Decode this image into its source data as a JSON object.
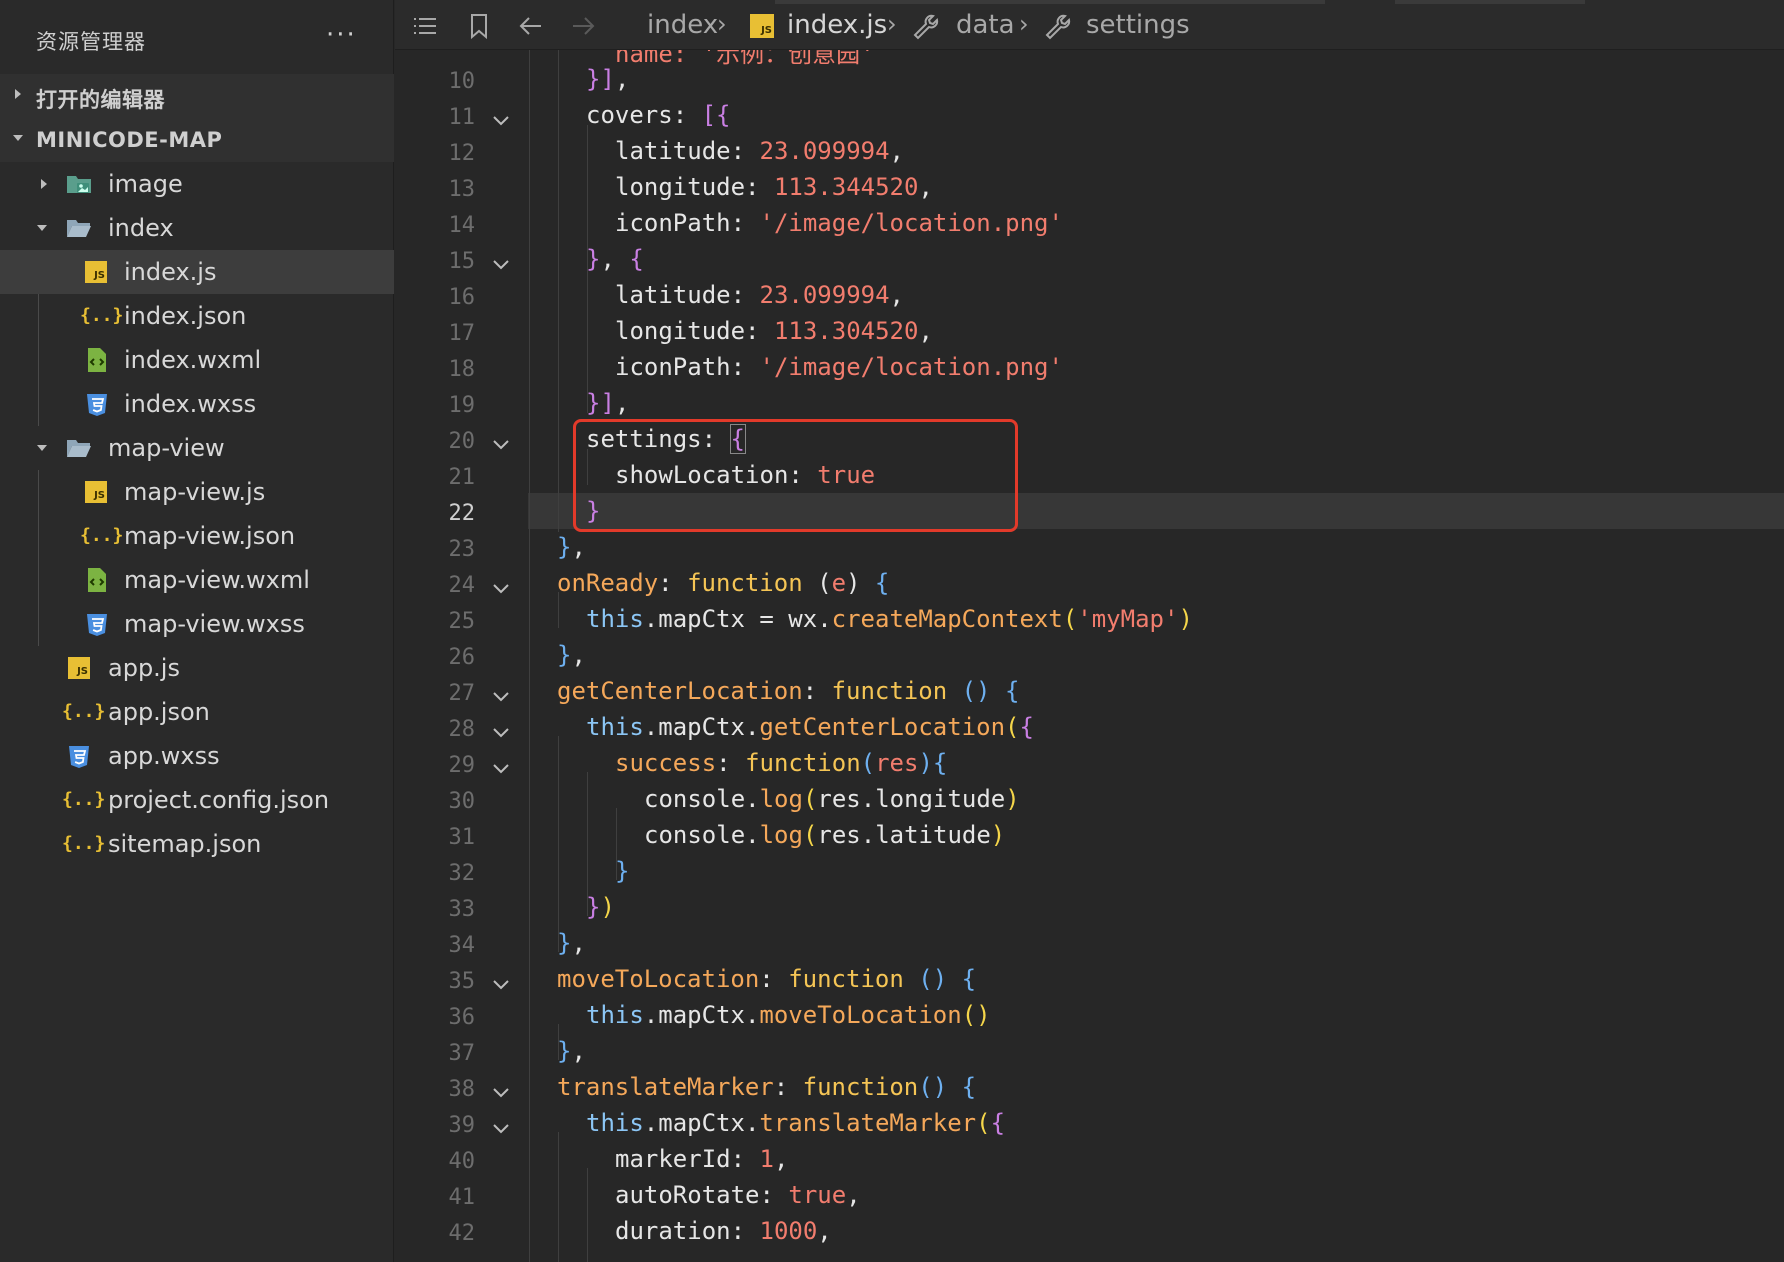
{
  "sidebar": {
    "title": "资源管理器",
    "more": "···",
    "sections": {
      "open_editors": "打开的编辑器",
      "project": "MINICODE-MAP"
    },
    "tree": [
      {
        "label": "image",
        "kind": "folder-image"
      },
      {
        "label": "index",
        "kind": "folder-open"
      },
      {
        "label": "index.js",
        "kind": "js"
      },
      {
        "label": "index.json",
        "kind": "json"
      },
      {
        "label": "index.wxml",
        "kind": "wxml"
      },
      {
        "label": "index.wxss",
        "kind": "wxss"
      },
      {
        "label": "map-view",
        "kind": "folder-open"
      },
      {
        "label": "map-view.js",
        "kind": "js"
      },
      {
        "label": "map-view.json",
        "kind": "json"
      },
      {
        "label": "map-view.wxml",
        "kind": "wxml"
      },
      {
        "label": "map-view.wxss",
        "kind": "wxss"
      },
      {
        "label": "app.js",
        "kind": "js"
      },
      {
        "label": "app.json",
        "kind": "json"
      },
      {
        "label": "app.wxss",
        "kind": "wxss"
      },
      {
        "label": "project.config.json",
        "kind": "json"
      },
      {
        "label": "sitemap.json",
        "kind": "json"
      }
    ]
  },
  "breadcrumb": {
    "folder": "index",
    "file": "index.js",
    "js_badge": "JS",
    "sym1": "data",
    "sym2": "settings"
  },
  "icons": {
    "list": "list-icon",
    "bookmark": "bookmark-icon",
    "back": "arrow-left-icon",
    "forward": "arrow-right-icon",
    "wrench": "wrench-icon"
  },
  "editor": {
    "current_line": "22",
    "line_numbers": [
      "10",
      "11",
      "12",
      "13",
      "14",
      "15",
      "16",
      "17",
      "18",
      "19",
      "20",
      "21",
      "22",
      "23",
      "24",
      "25",
      "26",
      "27",
      "28",
      "29",
      "30",
      "31",
      "32",
      "33",
      "34",
      "35",
      "36",
      "37",
      "38",
      "39",
      "40",
      "41",
      "42"
    ],
    "partial_top": "name: '示例：创意园'",
    "code": {
      "l10": [
        "}]",
        ","
      ],
      "l11": [
        "covers",
        ": ",
        "[{"
      ],
      "l12": [
        "latitude",
        ": ",
        "23.099994",
        ","
      ],
      "l13": [
        "longitude",
        ": ",
        "113.344520",
        ","
      ],
      "l14": [
        "iconPath",
        ": ",
        "'/image/location.png'"
      ],
      "l15": [
        "}",
        ", ",
        "{"
      ],
      "l16": [
        "latitude",
        ": ",
        "23.099994",
        ","
      ],
      "l17": [
        "longitude",
        ": ",
        "113.304520",
        ","
      ],
      "l18": [
        "iconPath",
        ": ",
        "'/image/location.png'"
      ],
      "l19": [
        "}]",
        ","
      ],
      "l20": [
        "settings",
        ": ",
        "{"
      ],
      "l21": [
        "showLocation",
        ": ",
        "true"
      ],
      "l22": [
        "}"
      ],
      "l23": [
        "}",
        ","
      ],
      "l24": [
        "onReady",
        ": ",
        "function",
        " (",
        "e",
        ") ",
        "{"
      ],
      "l25": [
        "this",
        ".mapCtx = wx.",
        "createMapContext",
        "(",
        "'myMap'",
        ")"
      ],
      "l26": [
        "}",
        ","
      ],
      "l27": [
        "getCenterLocation",
        ": ",
        "function",
        " () ",
        "{"
      ],
      "l28": [
        "this",
        ".mapCtx.",
        "getCenterLocation",
        "(",
        "{"
      ],
      "l29": [
        "success",
        ": ",
        "function",
        "(",
        "res",
        ")",
        "{"
      ],
      "l30": [
        "console.",
        "log",
        "(",
        "res.longitude",
        ")"
      ],
      "l31": [
        "console.",
        "log",
        "(",
        "res.latitude",
        ")"
      ],
      "l32": [
        "}"
      ],
      "l33": [
        "}",
        ")"
      ],
      "l34": [
        "}",
        ","
      ],
      "l35": [
        "moveToLocation",
        ": ",
        "function",
        " () ",
        "{"
      ],
      "l36": [
        "this",
        ".mapCtx.",
        "moveToLocation",
        "()"
      ],
      "l37": [
        "}",
        ","
      ],
      "l38": [
        "translateMarker",
        ": ",
        "function",
        "() ",
        "{"
      ],
      "l39": [
        "this",
        ".mapCtx.",
        "translateMarker",
        "(",
        "{"
      ],
      "l40": [
        "markerId",
        ": ",
        "1",
        ","
      ],
      "l41": [
        "autoRotate",
        ": ",
        "true",
        ","
      ],
      "l42": [
        "duration",
        ": ",
        "1000",
        ","
      ]
    }
  },
  "colors": {
    "highlight_box": "#e23a2a",
    "js_icon": "#e8bf34",
    "css_icon": "#4a8fe0",
    "wxml_icon": "#7cb342",
    "folder": "#8fa6b8"
  }
}
